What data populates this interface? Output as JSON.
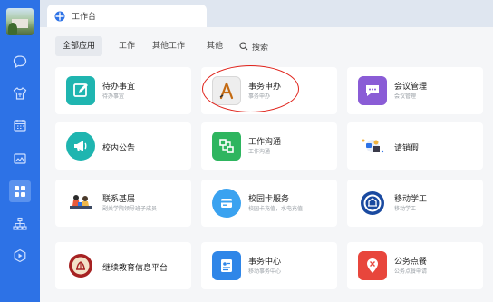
{
  "tab": {
    "title": "工作台"
  },
  "filters": {
    "all": "全部应用",
    "work": "工作",
    "other_work": "其他工作",
    "other": "其他",
    "search": "搜索"
  },
  "sidebar": {
    "items": [
      {
        "icon": "chat-icon"
      },
      {
        "icon": "shirt-icon"
      },
      {
        "icon": "calendar-icon"
      },
      {
        "icon": "image-icon"
      },
      {
        "icon": "apps-grid-icon",
        "active": true
      },
      {
        "icon": "org-chart-icon"
      },
      {
        "icon": "play-hexagon-icon"
      }
    ]
  },
  "apps": [
    {
      "title": "待办事宜",
      "subtitle": "待办事宜",
      "icon": "todo-edit-icon",
      "color": "#1fb5b0"
    },
    {
      "title": "事务申办",
      "subtitle": "事务申办",
      "icon": "affairs-app-icon",
      "color": "#eeeeee"
    },
    {
      "title": "会议管理",
      "subtitle": "会议管理",
      "icon": "meeting-chat-icon",
      "color": "#8a5cd6"
    },
    {
      "title": "校内公告",
      "subtitle": "",
      "icon": "megaphone-icon",
      "color": "#1fb5b0"
    },
    {
      "title": "工作沟通",
      "subtitle": "工作沟通",
      "icon": "communication-icon",
      "color": "#2eb55f"
    },
    {
      "title": "请销假",
      "subtitle": "",
      "icon": "leave-illustration-icon",
      "color": "#ffffff"
    },
    {
      "title": "联系基层",
      "subtitle": "副关学院领导班子成员",
      "icon": "contact-illustration-icon",
      "color": "#ffffff"
    },
    {
      "title": "校园卡服务",
      "subtitle": "校园卡充值，水电充值",
      "icon": "campus-card-icon",
      "color": "#3aa2f0"
    },
    {
      "title": "移动学工",
      "subtitle": "移动学工",
      "icon": "university-logo-icon",
      "color": "#1a4aa0"
    },
    {
      "title": "继续教育信息平台",
      "subtitle": "",
      "icon": "education-seal-icon",
      "color": "#a62222"
    },
    {
      "title": "事务中心",
      "subtitle": "移动事务中心",
      "icon": "affairs-center-icon",
      "color": "#2f86e8"
    },
    {
      "title": "公务点餐",
      "subtitle": "公务点餐申请",
      "icon": "dining-icon",
      "color": "#e8463c"
    }
  ],
  "colors": {
    "sidebar": "#2d72e6",
    "highlight": "#e0231b",
    "background": "#f5f6f8"
  }
}
